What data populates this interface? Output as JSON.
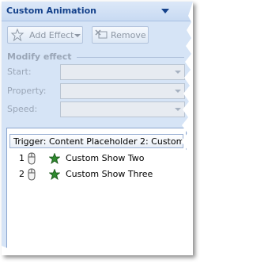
{
  "pane": {
    "title": "Custom Animation"
  },
  "toolbar": {
    "add_effect_label": "Add Effect",
    "remove_label": "Remove"
  },
  "modify_effect": {
    "heading": "Modify effect",
    "fields": [
      {
        "label": "Start:",
        "value": ""
      },
      {
        "label": "Property:",
        "value": ""
      },
      {
        "label": "Speed:",
        "value": ""
      }
    ]
  },
  "effect_list": {
    "trigger_label": "Trigger: Content Placeholder 2: Custom ...",
    "items": [
      {
        "number": "1",
        "label": "Custom Show Two",
        "trigger_icon": "mouse-click-icon",
        "effect_icon": "entrance-star-icon"
      },
      {
        "number": "2",
        "label": "Custom Show Three",
        "trigger_icon": "mouse-click-icon",
        "effect_icon": "entrance-star-icon"
      }
    ]
  },
  "colors": {
    "pane_background": "#d6e4f6",
    "title_text": "#15428b",
    "disabled_text": "#9aa6b7",
    "star_green": "#2f8a2f"
  }
}
